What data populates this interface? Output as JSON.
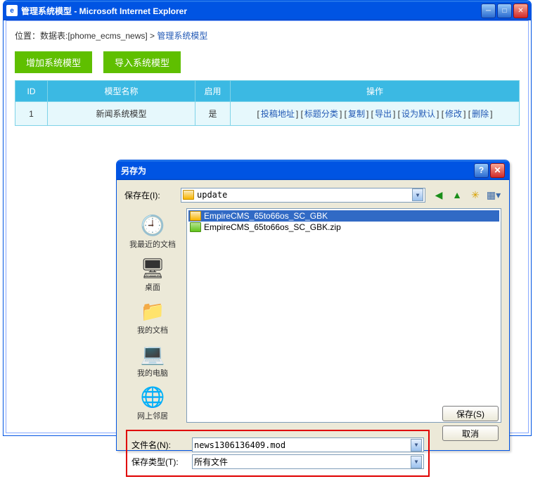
{
  "ie": {
    "title": "管理系统模型 - Microsoft Internet Explorer"
  },
  "breadcrumb": {
    "prefix": "位置：数据表:[phome_ecms_news] > ",
    "current": "管理系统模型"
  },
  "buttons": {
    "add_model": "增加系统模型",
    "import_model": "导入系统模型"
  },
  "table": {
    "headers": {
      "id": "ID",
      "name": "模型名称",
      "enabled": "启用",
      "ops": "操作"
    },
    "row": {
      "id": "1",
      "name": "新闻系统模型",
      "enabled": "是",
      "ops": {
        "submit_addr": "投稿地址",
        "title_cat": "标题分类",
        "copy": "复制",
        "export": "导出",
        "set_default": "设为默认",
        "edit": "修改",
        "delete": "删除"
      }
    }
  },
  "dialog": {
    "title": "另存为",
    "save_in_label": "保存在(I):",
    "folder": "update",
    "places": {
      "recent": "我最近的文档",
      "desktop": "桌面",
      "mydocs": "我的文档",
      "mycomp": "我的电脑",
      "network": "网上邻居"
    },
    "files": {
      "folder1": "EmpireCMS_65to66os_SC_GBK",
      "zip1": "EmpireCMS_65to66os_SC_GBK.zip"
    },
    "filename_label": "文件名(N):",
    "filename_value": "news1306136409.mod",
    "filetype_label": "保存类型(T):",
    "filetype_value": "所有文件",
    "save_btn": "保存(S)",
    "cancel_btn": "取消"
  }
}
